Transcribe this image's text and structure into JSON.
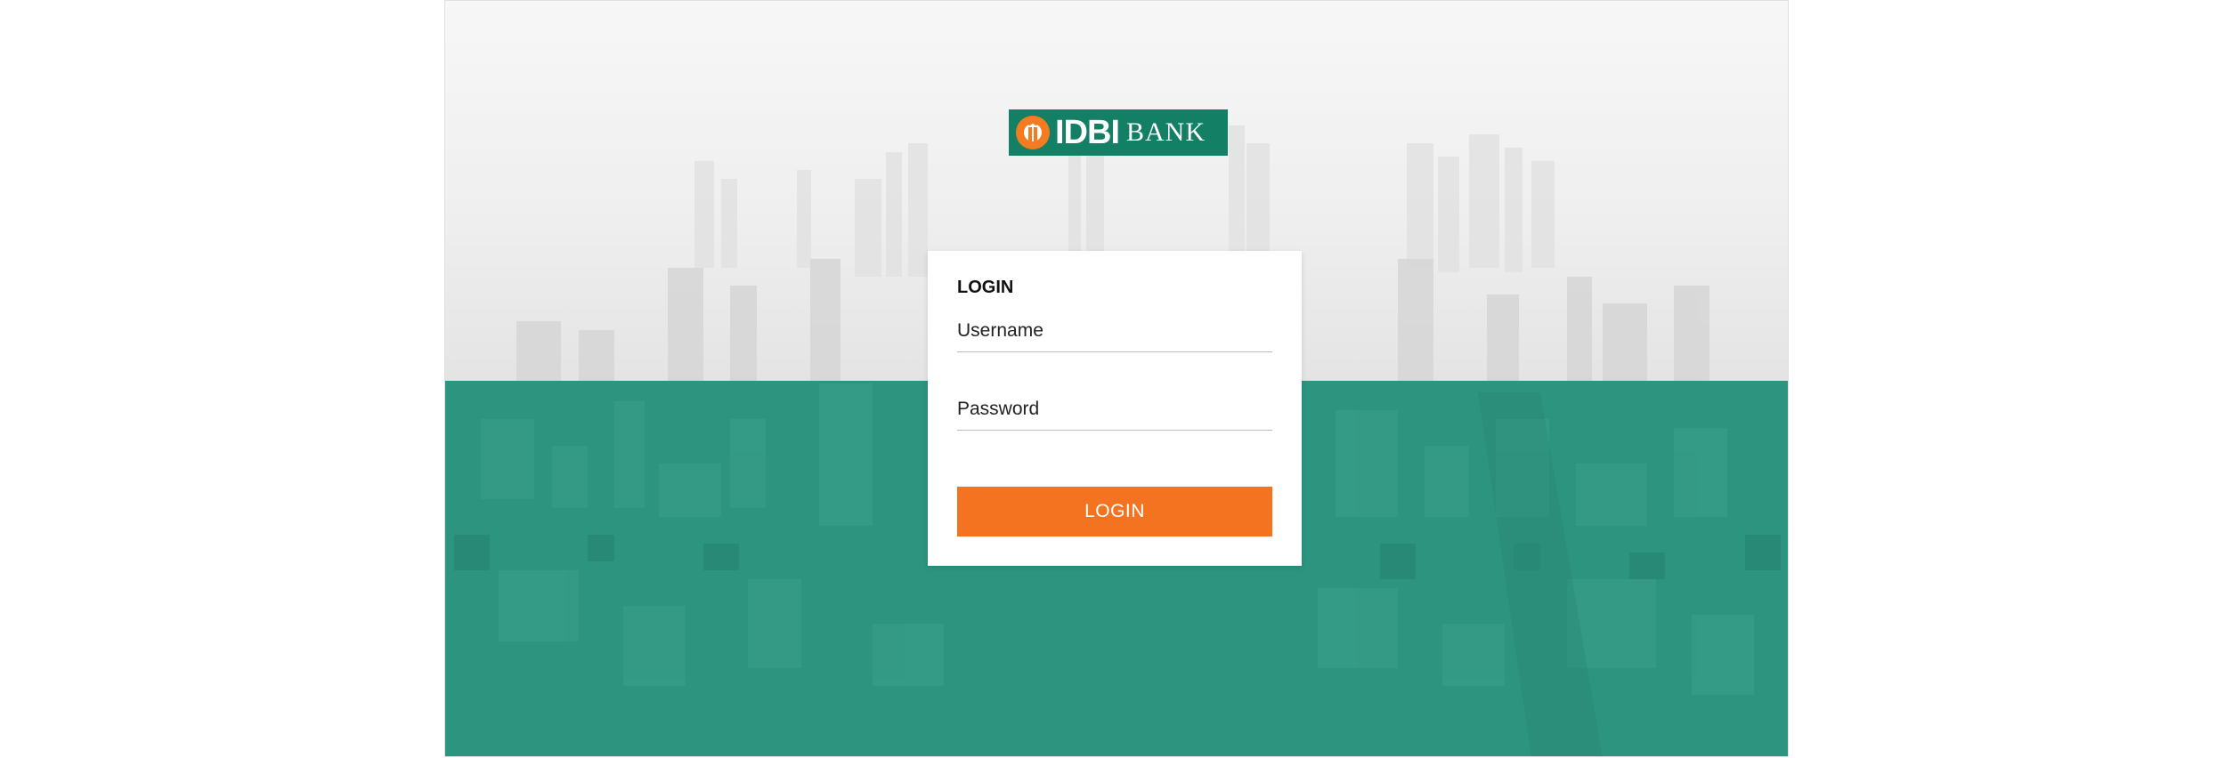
{
  "brand": {
    "logo_main": "IDBI",
    "logo_sub": "BANK",
    "logo_color": "#138065",
    "accent_color": "#f47b20"
  },
  "login_card": {
    "title": "LOGIN",
    "username_placeholder": "Username",
    "password_placeholder": "Password",
    "button_label": "LOGIN",
    "button_color": "#f47321"
  },
  "background": {
    "top_color": "#f3f3f3",
    "bottom_color": "#2d9480"
  }
}
